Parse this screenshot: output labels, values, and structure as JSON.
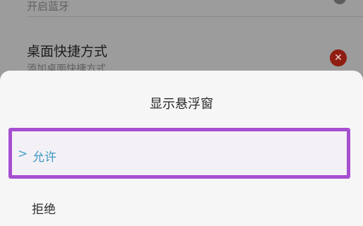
{
  "settings": {
    "bluetooth_subtitle": "开启蓝牙",
    "shortcut_title": "桌面快捷方式",
    "shortcut_subtitle": "添加桌面快捷方式",
    "shortcut_badge_icon": "close-icon"
  },
  "dialog": {
    "title": "显示悬浮窗",
    "options": [
      {
        "label": "允许",
        "selected": true
      },
      {
        "label": "拒绝",
        "selected": false
      }
    ]
  },
  "colors": {
    "highlight_border": "#a64fd1",
    "selected_text": "#3d99c3",
    "badge": "#8f1d12"
  }
}
